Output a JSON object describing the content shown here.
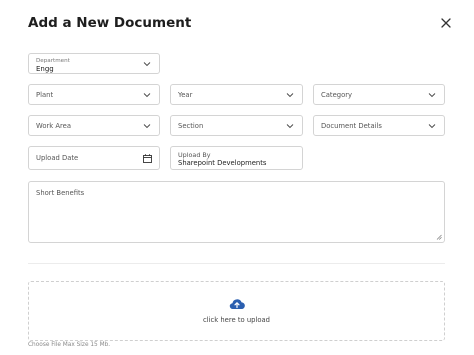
{
  "modal": {
    "title": "Add a New Document"
  },
  "icons": {
    "close": "close-icon",
    "chevron": "chevron-down-icon",
    "calendar": "calendar-icon",
    "upload": "cloud-upload-icon"
  },
  "colors": {
    "accent": "#2b5fb0",
    "border": "#d4d4d4"
  },
  "form": {
    "department": {
      "label": "Department",
      "value": "Engg"
    },
    "plant": {
      "label": "Plant"
    },
    "year": {
      "label": "Year"
    },
    "category": {
      "label": "Category"
    },
    "work_area": {
      "label": "Work Area"
    },
    "section": {
      "label": "Section"
    },
    "document_details": {
      "label": "Document Details"
    },
    "upload_date": {
      "label": "Upload Date"
    },
    "upload_by": {
      "label": "Upload By",
      "value": "Sharepoint Developments"
    },
    "short_benefits": {
      "label": "Short Benefits"
    }
  },
  "upload": {
    "cta": "click here to upload",
    "hint": "Choose File Max Size 15 Mb."
  }
}
